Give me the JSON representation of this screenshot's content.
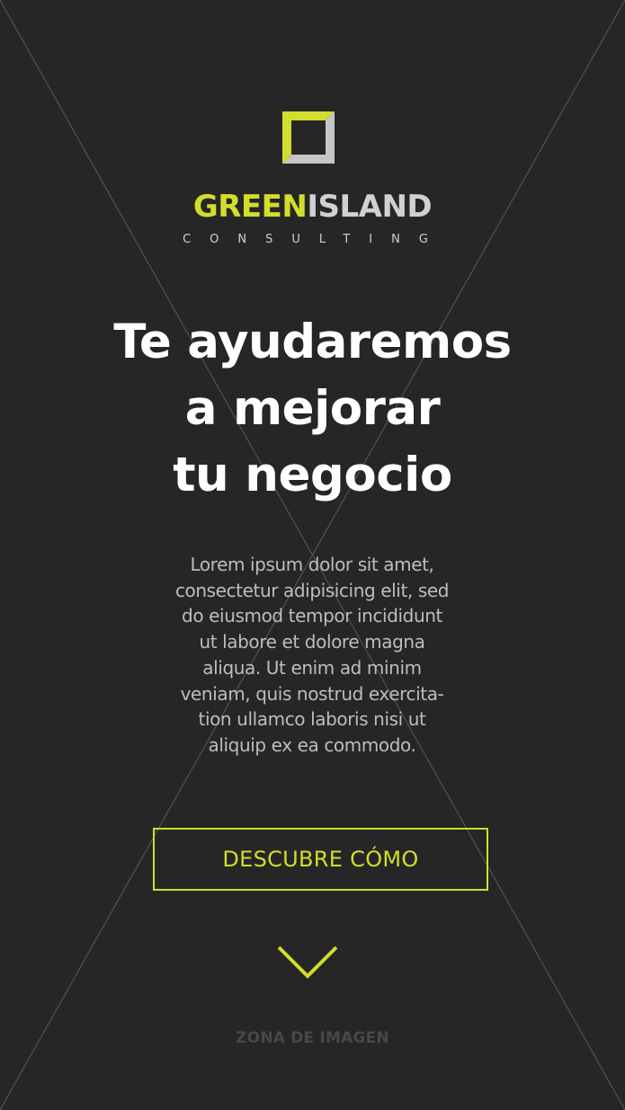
{
  "brand": {
    "name_part1": "GREEN",
    "name_part2": "ISLAND",
    "subtitle": "CONSULTING",
    "accent_color": "#d3dd2b",
    "logo_icon": "square-frame-logo-icon"
  },
  "hero": {
    "title_lines": [
      "Te ayudaremos",
      "a mejorar",
      "tu negocio"
    ],
    "body_lines": [
      "Lorem ipsum dolor sit amet,",
      "consectetur adipisicing elit, sed",
      "do eiusmod tempor incididunt",
      "ut labore et dolore magna",
      "aliqua. Ut enim ad minim",
      "veniam, quis nostrud exercita-",
      "tion ullamco laboris nisi ut",
      "aliquip ex ea commodo."
    ],
    "cta_label": "DESCUBRE CÓMO",
    "scroll_icon": "chevron-down-icon"
  },
  "placeholder": {
    "label": "ZONA DE IMAGEN"
  },
  "colors": {
    "background": "#262626",
    "title": "#ffffff",
    "body_text": "#bdbdbd",
    "placeholder_text": "#484848",
    "placeholder_lines": "#5a5a5a"
  }
}
